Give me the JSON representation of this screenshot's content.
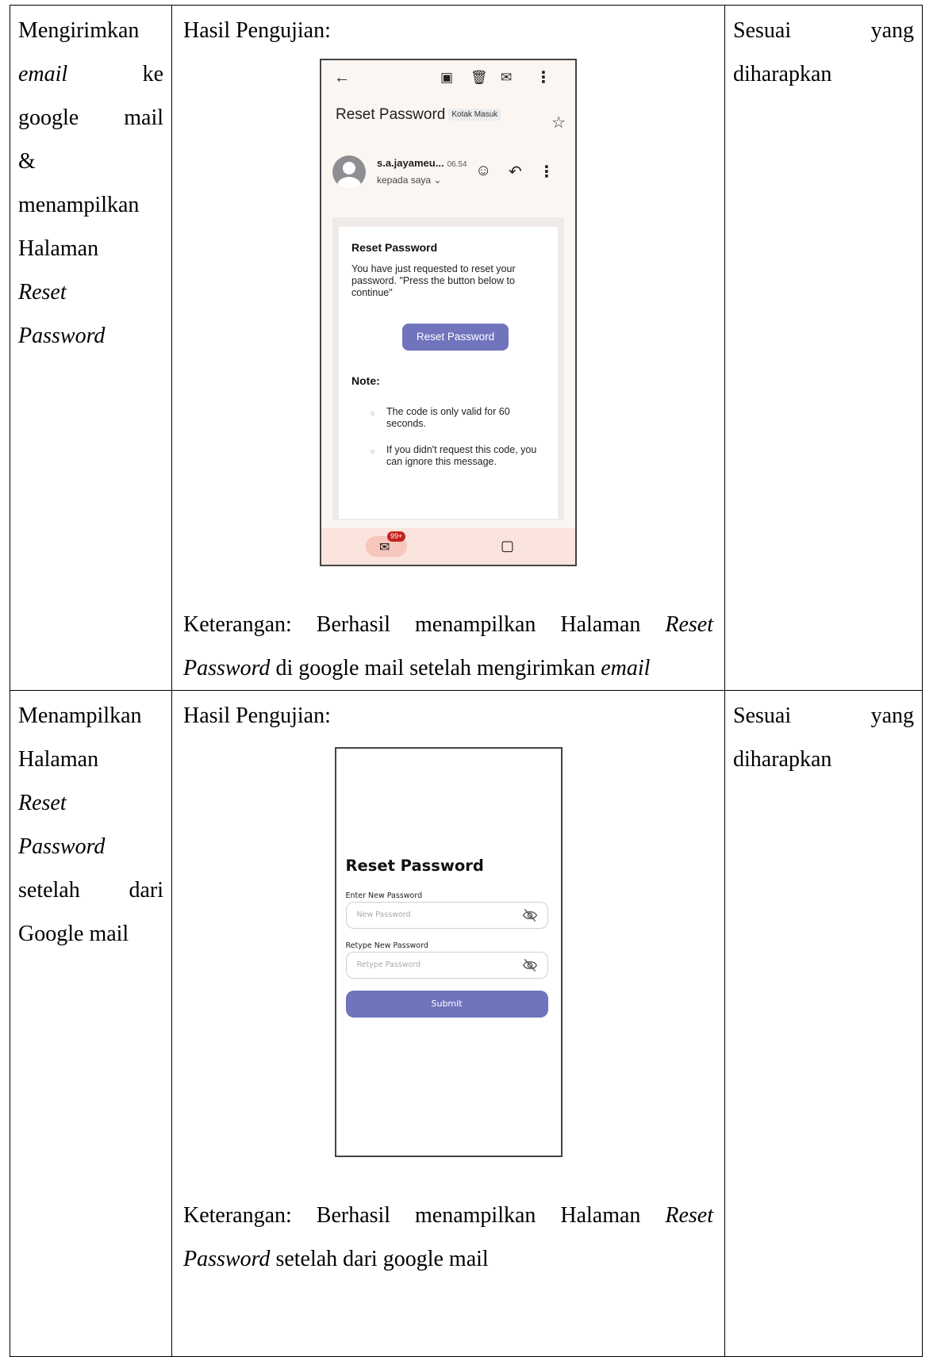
{
  "rows": [
    {
      "scenario_lines": [
        "Mengirimkan",
        [
          "email",
          "ke"
        ],
        [
          "google",
          "mail"
        ],
        "&",
        "menampilkan",
        "Halaman",
        "Reset",
        "Password"
      ],
      "result_heading": "Hasil Pengujian:",
      "status": [
        "Sesuai",
        "yang",
        "diharapkan"
      ],
      "keterangan_line1": [
        "Keterangan:",
        "Berhasil",
        "menampilkan",
        "Halaman",
        "Reset"
      ],
      "keterangan_line2": {
        "italic_a": "Password",
        "text": " di google mail setelah mengirimkan ",
        "italic_b": "email"
      }
    },
    {
      "scenario_lines": [
        "Menampilkan",
        "Halaman",
        "Reset",
        "Password",
        [
          "setelah",
          "dari"
        ],
        [
          "Google",
          "mail"
        ]
      ],
      "result_heading": "Hasil Pengujian:",
      "status": [
        "Sesuai",
        "yang",
        "diharapkan"
      ],
      "keterangan_line1": [
        "Keterangan:",
        "Berhasil",
        "menampilkan",
        "Halaman",
        "Reset"
      ],
      "keterangan_line2": {
        "italic_a": "Password",
        "text": " setelah dari google mail"
      }
    }
  ],
  "gmail": {
    "subject": "Reset Password",
    "label_badge": "Kotak Masuk",
    "sender": "s.a.jayameu...",
    "time": "06.54",
    "to": "kepada saya",
    "card_title": "Reset Password",
    "card_text": "You have just requested to reset your password. \"Press the button below to continue\"",
    "button": "Reset Password",
    "note_title": "Note:",
    "note_items": [
      "The code is only valid for 60 seconds.",
      "If you didn't request this code, you can ignore this message."
    ],
    "unread_count": "99+",
    "icons": [
      "back-arrow-icon",
      "archive-icon",
      "trash-icon",
      "mark-unread-icon",
      "more-vert-icon",
      "star-icon",
      "emoji-icon",
      "reply-icon",
      "mail-icon",
      "video-icon"
    ]
  },
  "app": {
    "title": "Reset Password",
    "new_password_label": "Enter New Password",
    "new_password_placeholder": "New Password",
    "retype_label": "Retype New Password",
    "retype_placeholder": "Retype Password",
    "submit": "Submit",
    "accent": "#6f74bd"
  }
}
